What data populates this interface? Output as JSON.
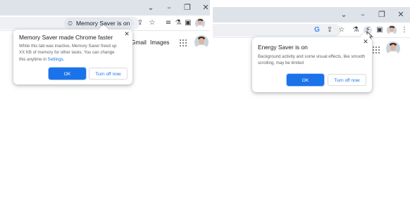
{
  "left_window": {
    "window_controls": {
      "chevron": "⌄",
      "minimize": "–",
      "restore": "❐",
      "close": "✕"
    },
    "memory_chip": {
      "icon": "memory-saver-icon",
      "label": "Memory Saver is on"
    },
    "toolbar_icons": [
      "share-icon",
      "star-icon",
      "reading-list-icon",
      "labs-flask-icon",
      "side-panel-icon"
    ],
    "page_links": {
      "gmail": "Gmail",
      "images": "Images"
    },
    "bubble": {
      "title": "Memory Saver made Chrome faster",
      "body_before_link": "While this tab was inactive, Memory Saver freed up XX KB of memory for other tasks. You can change this anytime in ",
      "body_link": "Settings",
      "body_after_link": ".",
      "ok_label": "OK",
      "turn_off_label": "Turn off now"
    }
  },
  "right_window": {
    "window_controls": {
      "chevron": "⌄",
      "minimize": "–",
      "restore": "❐",
      "close": "✕"
    },
    "toolbar_icons": [
      "google-icon",
      "share-icon",
      "star-icon",
      "labs-flask-icon",
      "energy-saver-icon",
      "side-panel-icon"
    ],
    "bubble": {
      "title": "Energy Saver is on",
      "body": "Background activity and some visual effects, like smooth scrolling, may be limited",
      "ok_label": "OK",
      "turn_off_label": "Turn off now"
    }
  },
  "colors": {
    "accent": "#1a73e8",
    "titlebar": "#dee3ea",
    "chip": "#e3e7ee",
    "google_blue": "#4285f4"
  }
}
